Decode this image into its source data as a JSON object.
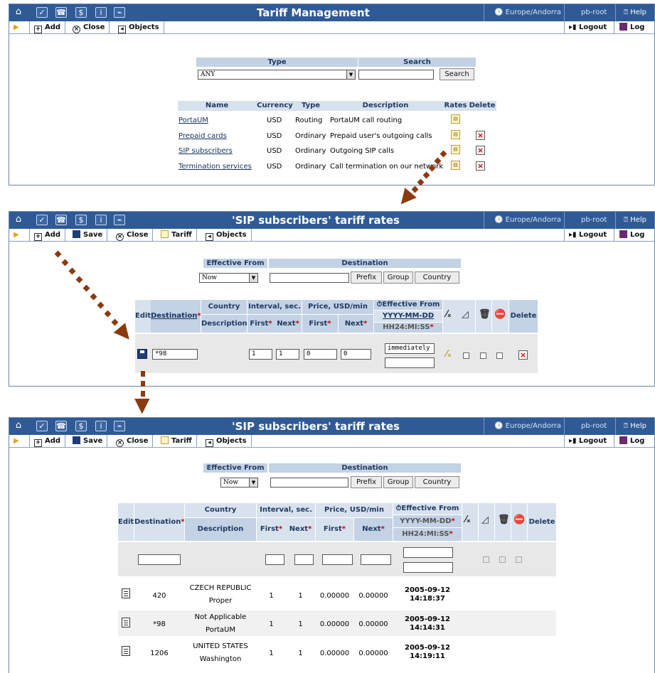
{
  "titlebar_icons": [
    "home-icon",
    "checklist-icon",
    "phone-icon",
    "dollar-icon",
    "info-icon",
    "chart-icon"
  ],
  "panel1": {
    "title": "Tariff Management",
    "timezone": "Europe/Andorra",
    "user": "pb-root",
    "help": "Help",
    "toolbar": {
      "add": "Add",
      "close": "Close",
      "objects": "Objects",
      "logout": "Logout",
      "log": "Log"
    },
    "filter": {
      "type_header": "Type",
      "search_header": "Search",
      "type_value": "ANY",
      "search_value": "",
      "search_button": "Search"
    },
    "table": {
      "headers": [
        "Name",
        "Currency",
        "Type",
        "Description",
        "Rates",
        "Delete"
      ],
      "rows": [
        {
          "name": "PortaUM",
          "currency": "USD",
          "type": "Routing",
          "description": "PortaUM call routing",
          "deletable": false
        },
        {
          "name": "Prepaid cards",
          "currency": "USD",
          "type": "Ordinary",
          "description": "Prepaid user's outgoing calls",
          "deletable": true
        },
        {
          "name": "SIP subscribers",
          "currency": "USD",
          "type": "Ordinary",
          "description": "Outgoing SIP calls",
          "deletable": true
        },
        {
          "name": "Termination services",
          "currency": "USD",
          "type": "Ordinary",
          "description": "Call termination on our network",
          "deletable": true
        }
      ]
    }
  },
  "panel2": {
    "title": "'SIP subscribers' tariff rates",
    "timezone": "Europe/Andorra",
    "user": "pb-root",
    "help": "Help",
    "toolbar": {
      "add": "Add",
      "save": "Save",
      "close": "Close",
      "tariff": "Tariff",
      "objects": "Objects",
      "logout": "Logout",
      "log": "Log"
    },
    "filter": {
      "effective_from_header": "Effective From",
      "destination_header": "Destination",
      "effective_value": "Now",
      "destination_value": "",
      "prefix_button": "Prefix",
      "group_button": "Group",
      "country_button": "Country"
    },
    "table": {
      "edit": "Edit",
      "destination": "Destination",
      "country": "Country",
      "description": "Description",
      "interval": "Interval, sec.",
      "first": "First",
      "next": "Next",
      "price": "Price, USD/min",
      "effective_from": "Effective From",
      "date_format": "YYYY-MM-DD",
      "time_format": "HH24:MI:SS",
      "delete": "Delete"
    },
    "edit_row": {
      "destination": "*98",
      "interval_first": "1",
      "interval_next": "1",
      "price_first": "0",
      "price_next": "0",
      "effective": "immediately",
      "effective2": ""
    }
  },
  "panel3": {
    "title": "'SIP subscribers' tariff rates",
    "timezone": "Europe/Andorra",
    "user": "pb-root",
    "help": "Help",
    "toolbar": {
      "add": "Add",
      "save": "Save",
      "close": "Close",
      "tariff": "Tariff",
      "objects": "Objects",
      "logout": "Logout",
      "log": "Log"
    },
    "filter": {
      "effective_from_header": "Effective From",
      "destination_header": "Destination",
      "effective_value": "Now",
      "destination_value": "",
      "prefix_button": "Prefix",
      "group_button": "Group",
      "country_button": "Country"
    },
    "table": {
      "edit": "Edit",
      "destination": "Destination",
      "country": "Country",
      "description": "Description",
      "interval": "Interval, sec.",
      "first": "First",
      "next": "Next",
      "price": "Price, USD/min",
      "effective_from": "Effective From",
      "date_format": "YYYY-MM-DD",
      "time_format": "HH24:MI:SS",
      "delete": "Delete"
    },
    "rows": [
      {
        "destination": "420",
        "country": "CZECH REPUBLIC",
        "description": "Proper",
        "interval_first": "1",
        "interval_next": "1",
        "price_first": "0.00000",
        "price_next": "0.00000",
        "date": "2005-09-12",
        "time": "14:18:37"
      },
      {
        "destination": "*98",
        "country": "Not Applicable",
        "description": "PortaUM",
        "interval_first": "1",
        "interval_next": "1",
        "price_first": "0.00000",
        "price_next": "0.00000",
        "date": "2005-09-12",
        "time": "14:14:31"
      },
      {
        "destination": "1206",
        "country": "UNITED STATES",
        "description": "Washington",
        "interval_first": "1",
        "interval_next": "1",
        "price_first": "0.00000",
        "price_next": "0.00000",
        "date": "2005-09-12",
        "time": "14:19:11"
      }
    ]
  }
}
